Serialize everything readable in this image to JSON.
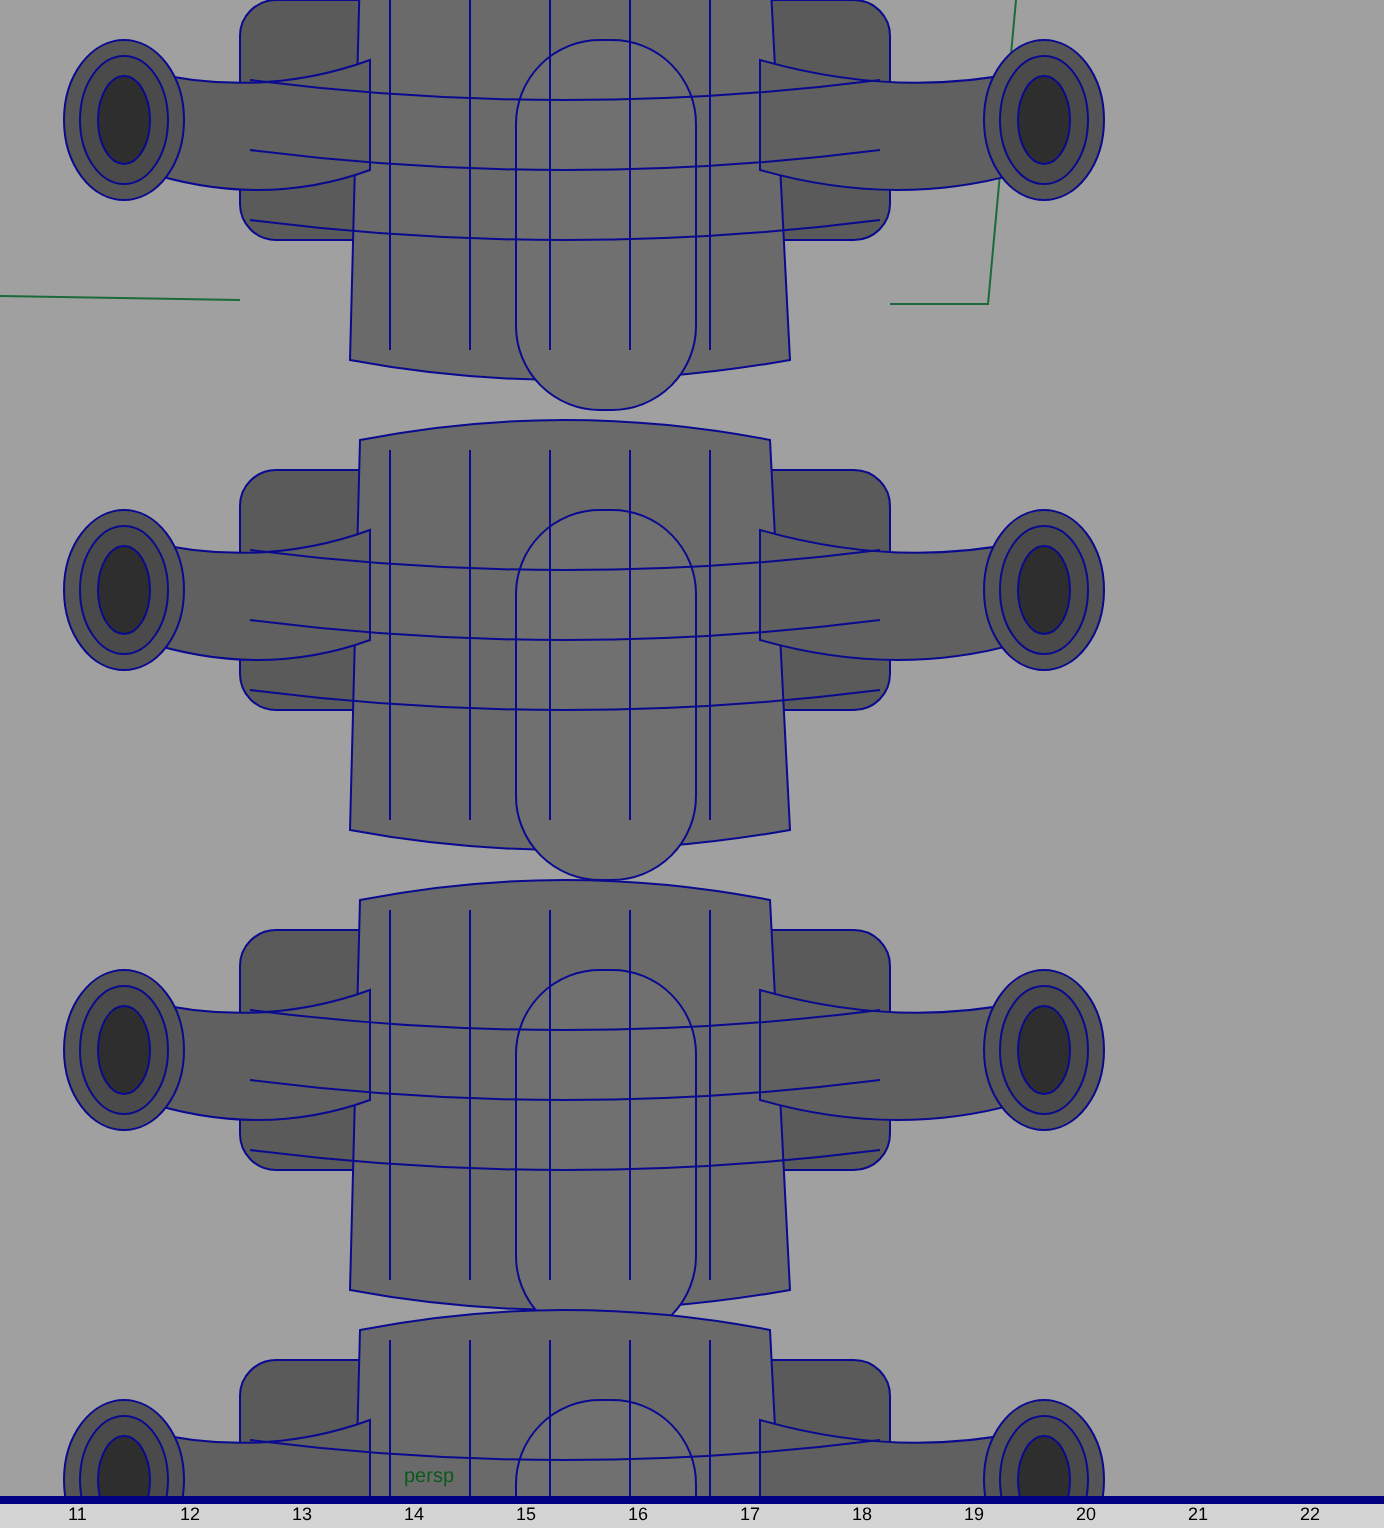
{
  "viewport": {
    "camera_label": "persp"
  },
  "timeline": {
    "frame_labels": [
      "11",
      "12",
      "13",
      "14",
      "15",
      "16",
      "17",
      "18",
      "19",
      "20",
      "21",
      "22"
    ]
  }
}
